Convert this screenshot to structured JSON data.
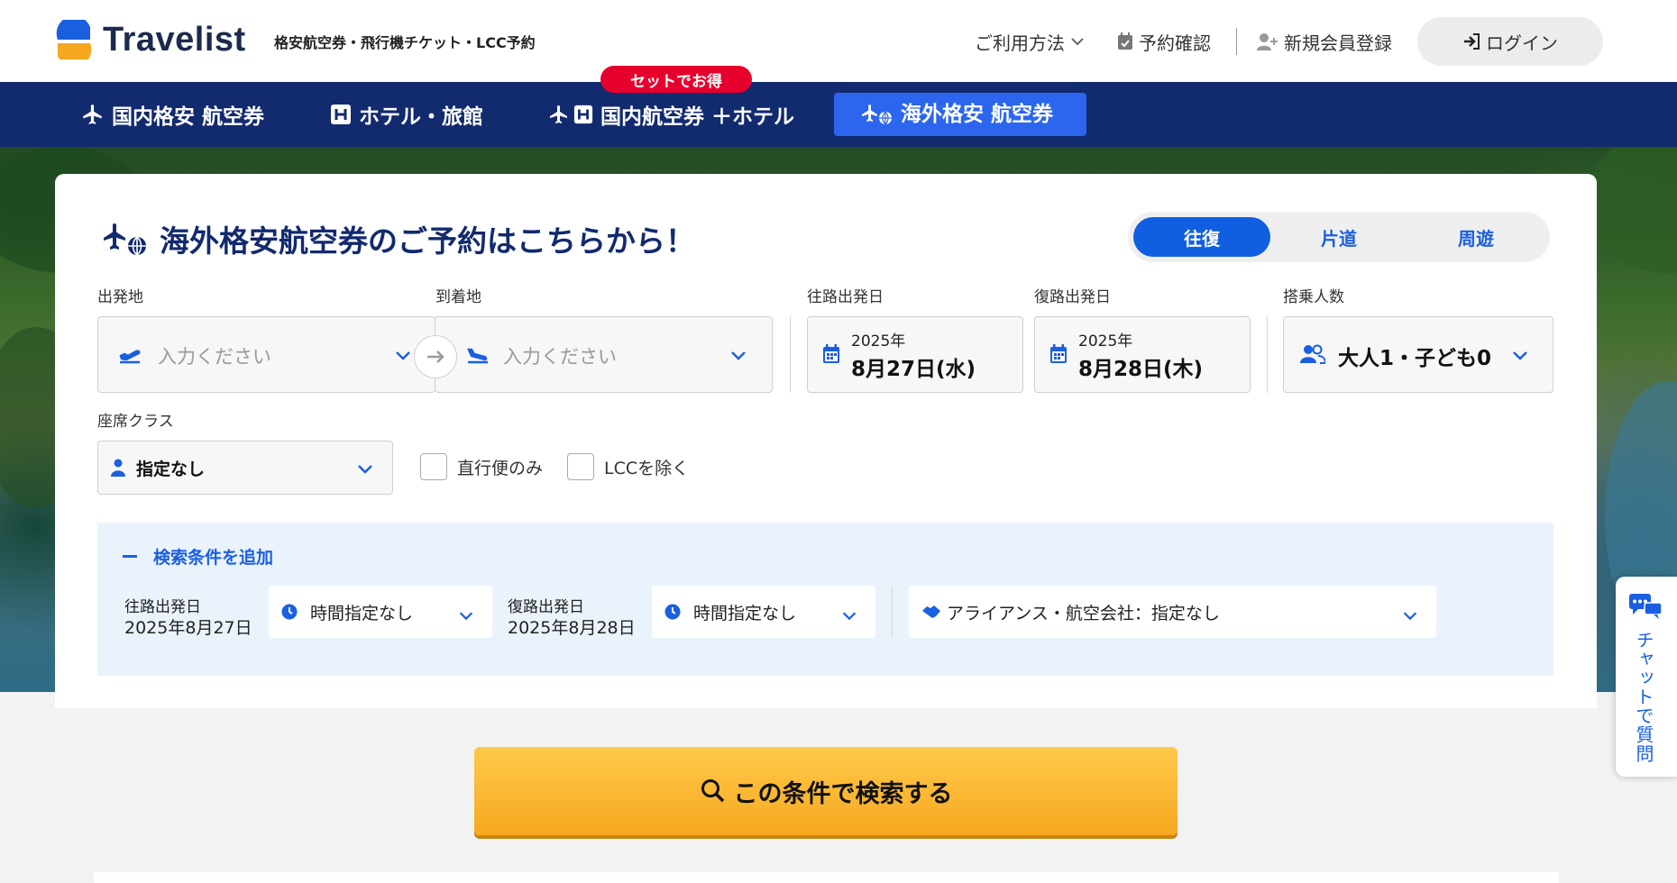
{
  "header": {
    "logo_text": "Travelist",
    "tagline": "格安航空券・飛行機チケット・LCC予約",
    "nav": {
      "usage": "ご利用方法",
      "booking_check": "予約確認",
      "register": "新規会員登録",
      "login": "ログイン"
    }
  },
  "navbar": {
    "tabs": [
      {
        "label": "国内格安 航空券",
        "icon": "airplane-icon"
      },
      {
        "label": "ホテル・旅館",
        "icon": "hotel-icon"
      },
      {
        "label": "国内航空券 ＋ホテル",
        "icon": "airplane-hotel-icon"
      },
      {
        "label": "海外格安 航空券",
        "icon": "airplane-globe-icon",
        "active": true
      }
    ],
    "promo_badge": "セットでお得"
  },
  "search": {
    "title": "海外格安航空券のご予約はこちらから！",
    "trip_types": [
      {
        "label": "往復",
        "selected": true
      },
      {
        "label": "片道",
        "selected": false
      },
      {
        "label": "周遊",
        "selected": false
      }
    ],
    "origin": {
      "label": "出発地",
      "placeholder": "入力ください"
    },
    "destination": {
      "label": "到着地",
      "placeholder": "入力ください"
    },
    "depart_date": {
      "label": "往路出発日",
      "year": "2025年",
      "day": "8月27日(水)"
    },
    "return_date": {
      "label": "復路出発日",
      "year": "2025年",
      "day": "8月28日(木)"
    },
    "passengers": {
      "label": "搭乗人数",
      "value": "大人1・子ども0"
    },
    "seat_class": {
      "label": "座席クラス",
      "value": "指定なし"
    },
    "options": {
      "direct_only": {
        "label": "直行便のみ",
        "checked": false
      },
      "exclude_lcc": {
        "label": "LCCを除く",
        "checked": false
      }
    },
    "extra": {
      "toggle": "検索条件を追加",
      "depart_label": "往路出発日",
      "depart_date": "2025年8月27日",
      "depart_time": "時間指定なし",
      "return_label": "復路出発日",
      "return_date": "2025年8月28日",
      "return_time": "時間指定なし",
      "airline": "アライアンス・航空会社：指定なし"
    },
    "submit": "この条件で検索する"
  },
  "chat": {
    "label": "チャットで質問"
  },
  "colors": {
    "navy": "#122a6e",
    "accent_blue": "#1a5fe0",
    "promo_red": "#e6002d",
    "search_orange": "#f6a820"
  }
}
